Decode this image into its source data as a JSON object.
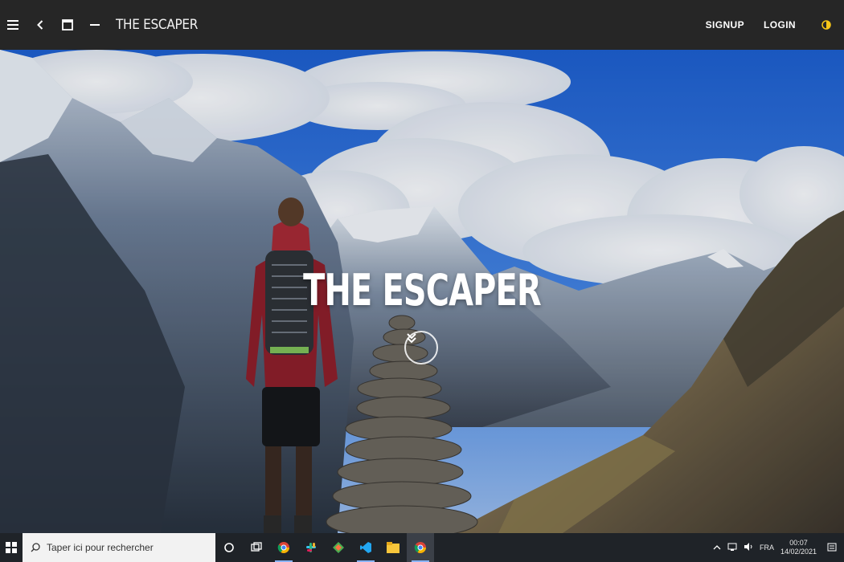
{
  "app": {
    "brand": "THE ESCAPER",
    "nav": {
      "signup_label": "SIGNUP",
      "login_label": "LOGIN"
    },
    "icons": {
      "menu": "hamburger-icon",
      "back": "chevron-left-icon",
      "window": "window-icon",
      "minimize": "minus-icon",
      "theme": "half-moon-icon"
    }
  },
  "hero": {
    "title": "THE ESCAPER",
    "scroll_icon": "double-chevron-down-icon"
  },
  "taskbar": {
    "search_placeholder": "Taper ici pour rechercher",
    "apps": [
      "cortana-icon",
      "task-view-icon",
      "chrome-icon",
      "slack-icon",
      "app-icon",
      "vscode-icon",
      "file-explorer-icon",
      "chrome-icon"
    ],
    "language": "FRA",
    "time": "00:07",
    "date": "14/02/2021"
  },
  "colors": {
    "topbar": "#262626",
    "taskbar": "#1f2328",
    "sky": "#2a6fd6",
    "accent_theme": "#f5c518"
  }
}
